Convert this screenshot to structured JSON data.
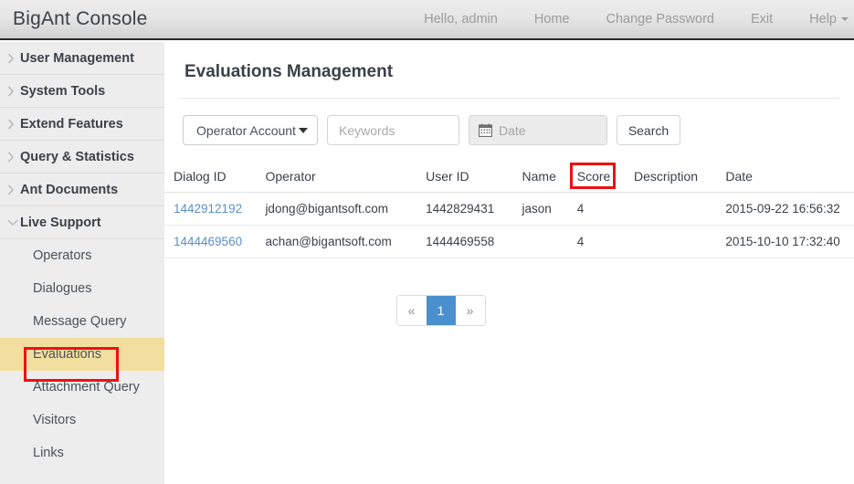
{
  "topbar": {
    "brand": "BigAnt Console",
    "nav": [
      {
        "label": "Hello, admin",
        "name": "greeting"
      },
      {
        "label": "Home",
        "name": "home"
      },
      {
        "label": "Change Password",
        "name": "change-password"
      },
      {
        "label": "Exit",
        "name": "exit"
      },
      {
        "label": "Help",
        "name": "help"
      }
    ]
  },
  "sidebar": {
    "groups": [
      {
        "label": "User Management",
        "icon": "chevron-right-icon",
        "expanded": false
      },
      {
        "label": "System Tools",
        "icon": "chevron-right-icon",
        "expanded": false
      },
      {
        "label": "Extend Features",
        "icon": "chevron-right-icon",
        "expanded": false
      },
      {
        "label": "Query & Statistics",
        "icon": "chevron-right-icon",
        "expanded": false
      },
      {
        "label": "Ant Documents",
        "icon": "chevron-right-icon",
        "expanded": false
      },
      {
        "label": "Live Support",
        "icon": "chevron-down-icon",
        "expanded": true
      }
    ],
    "sub_items": [
      {
        "label": "Operators",
        "active": false
      },
      {
        "label": "Dialogues",
        "active": false
      },
      {
        "label": "Message Query",
        "active": false
      },
      {
        "label": "Evaluations",
        "active": true
      },
      {
        "label": "Attachment Query",
        "active": false
      },
      {
        "label": "Visitors",
        "active": false
      },
      {
        "label": "Links",
        "active": false
      }
    ],
    "active_highlight_color": "#f2dfa0"
  },
  "main": {
    "page_title": "Evaluations Management",
    "toolbar": {
      "select_value": "Operator Account",
      "select_icon": "caret-down-icon",
      "keywords_placeholder": "Keywords",
      "keywords_value": "",
      "date_placeholder": "Date",
      "date_icon": "calendar-icon",
      "search_label": "Search"
    },
    "table": {
      "columns": [
        "Dialog ID",
        "Operator",
        "User ID",
        "Name",
        "Score",
        "Description",
        "Date"
      ],
      "rows": [
        {
          "dialog_id": "1442912192",
          "operator": "jdong@bigantsoft.com",
          "user_id": "1442829431",
          "name": "jason",
          "score": "4",
          "description": "",
          "date": "2015-09-22 16:56:32"
        },
        {
          "dialog_id": "1444469560",
          "operator": "achan@bigantsoft.com",
          "user_id": "1444469558",
          "name": "",
          "score": "4",
          "description": "",
          "date": "2015-10-10 17:32:40"
        }
      ]
    },
    "pagination": {
      "prev_label": "«",
      "next_label": "»",
      "pages": [
        "1"
      ],
      "current_page": "1",
      "active_color": "#4a90cf"
    }
  },
  "annotations": {
    "color": "#ee1111",
    "boxes": [
      "Evaluations",
      "Score"
    ]
  }
}
